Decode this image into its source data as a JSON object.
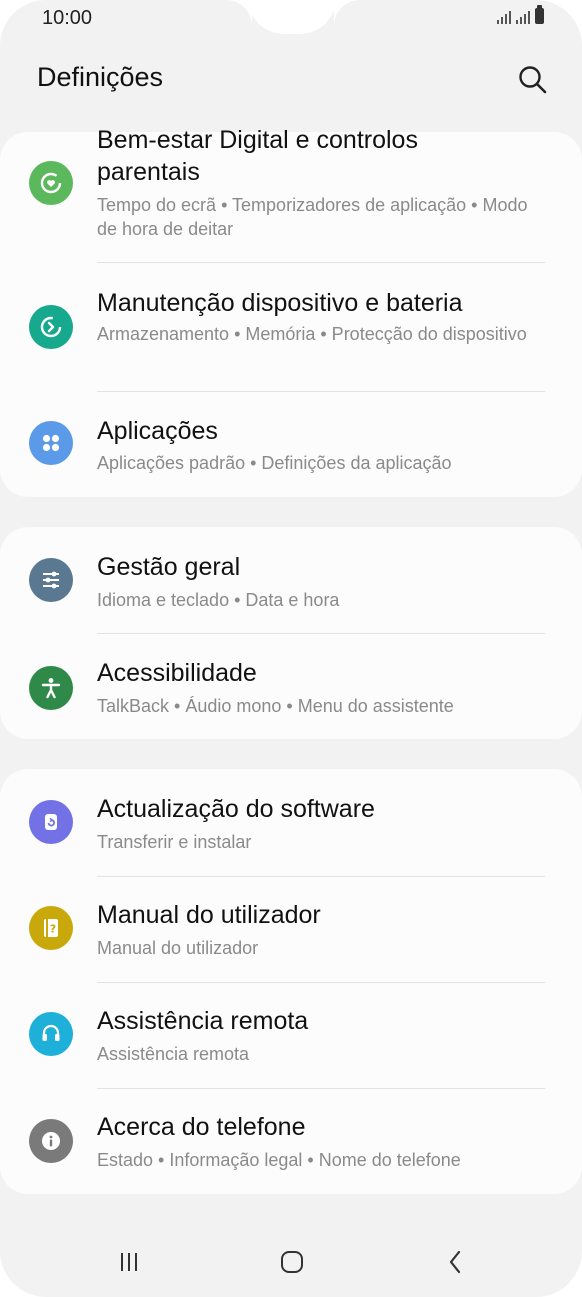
{
  "status_bar": {
    "time": "10:00"
  },
  "header": {
    "title": "Definições"
  },
  "groups": [
    {
      "items": [
        {
          "title_line1": "Bem-estar Digital e controlos",
          "title_line2": "parentais",
          "subtitle": "Tempo do ecrã  •  Temporizadores de aplicação  •  Modo de hora de deitar",
          "icon": "digital-wellbeing-icon",
          "color": "#5cb85c"
        },
        {
          "title": "Manutenção dispositivo e bateria",
          "subtitle": "Armazenamento  •  Memória  •  Protecção do dispositivo",
          "icon": "device-care-icon",
          "color": "#17a98e"
        },
        {
          "title": "Aplicações",
          "subtitle": "Aplicações padrão  •  Definições da aplicação",
          "icon": "apps-icon",
          "color": "#5b9ae8"
        }
      ]
    },
    {
      "items": [
        {
          "title": "Gestão geral",
          "subtitle": "Idioma e teclado  •  Data e hora",
          "icon": "general-management-icon",
          "color": "#5a7890"
        },
        {
          "title": "Acessibilidade",
          "subtitle": "TalkBack  •  Áudio mono  •  Menu do assistente",
          "icon": "accessibility-icon",
          "color": "#2f8a4a"
        }
      ]
    },
    {
      "items": [
        {
          "title": "Actualização do software",
          "subtitle": "Transferir e instalar",
          "icon": "software-update-icon",
          "color": "#7272e6"
        },
        {
          "title": "Manual do utilizador",
          "subtitle": "Manual do utilizador",
          "icon": "user-manual-icon",
          "color": "#c9a80c"
        },
        {
          "title": "Assistência remota",
          "subtitle": "Assistência remota",
          "icon": "remote-support-icon",
          "color": "#1eb0d8"
        },
        {
          "title": "Acerca do telefone",
          "subtitle": "Estado  •  Informação legal  •  Nome do telefone",
          "icon": "about-phone-icon",
          "color": "#7a7a7a"
        }
      ]
    }
  ]
}
